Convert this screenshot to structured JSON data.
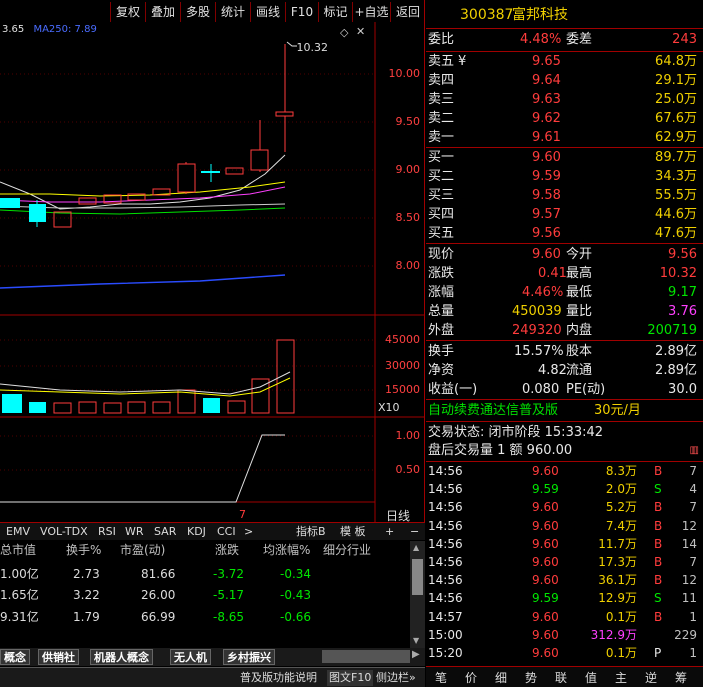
{
  "toolbar": {
    "items": [
      "复权",
      "叠加",
      "多股",
      "统计",
      "画线",
      "F10",
      "标记",
      "+自选",
      "返回"
    ]
  },
  "ma_label_left": "3.65",
  "ma_label": "MA250: 7.89",
  "high_mark": "10.32",
  "price_axis": [
    "10.00",
    "9.50",
    "9.00",
    "8.50",
    "8.00"
  ],
  "vol_axis": [
    "45000",
    "30000",
    "15000"
  ],
  "vol_unit": "X10",
  "ind_axis": [
    "1.00",
    "0.50"
  ],
  "period_label": "日线",
  "day_marker": "7",
  "indicator_tabs": [
    "EMV",
    "VOL-TDX",
    "RSI",
    "WR",
    "SAR",
    "KDJ",
    "CCI",
    ">"
  ],
  "indicator_extra": {
    "zhibiao": "指标B",
    "moban": "模 板",
    "plus": "+",
    "minus": "−"
  },
  "table": {
    "headers": [
      "总市值",
      "换手%",
      "市盈(动)",
      "涨跌",
      "均涨幅%",
      "细分行业"
    ],
    "rows": [
      [
        "1.00亿",
        "2.73",
        "81.66",
        "-3.72",
        "-0.34"
      ],
      [
        "1.65亿",
        "3.22",
        "26.00",
        "-5.17",
        "-0.43"
      ],
      [
        "9.31亿",
        "1.79",
        "66.99",
        "-8.65",
        "-0.66"
      ]
    ]
  },
  "concept_tabs": [
    "机器人概念",
    "供销社",
    "机器人概念",
    "无人机",
    "乡村振兴"
  ],
  "concept_tab_first": "概念",
  "status_bar": [
    "普及版功能说明",
    "图文F10",
    "侧边栏»"
  ],
  "stock": {
    "code": "300387",
    "name": "富邦科技"
  },
  "weibi": {
    "label": "委比",
    "value": "4.48%",
    "diff_label": "委差",
    "diff": "243"
  },
  "asks": [
    {
      "label": "卖五",
      "mark": "¥",
      "price": "9.65",
      "vol": "64.8万"
    },
    {
      "label": "卖四",
      "mark": "",
      "price": "9.64",
      "vol": "29.1万"
    },
    {
      "label": "卖三",
      "mark": "",
      "price": "9.63",
      "vol": "25.0万"
    },
    {
      "label": "卖二",
      "mark": "",
      "price": "9.62",
      "vol": "67.6万"
    },
    {
      "label": "卖一",
      "mark": "",
      "price": "9.61",
      "vol": "62.9万"
    }
  ],
  "bids": [
    {
      "label": "买一",
      "price": "9.60",
      "vol": "89.7万"
    },
    {
      "label": "买二",
      "price": "9.59",
      "vol": "34.3万"
    },
    {
      "label": "买三",
      "price": "9.58",
      "vol": "55.5万"
    },
    {
      "label": "买四",
      "price": "9.57",
      "vol": "44.6万"
    },
    {
      "label": "买五",
      "price": "9.56",
      "vol": "47.6万"
    }
  ],
  "quote": [
    {
      "l1": "现价",
      "v1": "9.60",
      "l2": "今开",
      "v2": "9.56"
    },
    {
      "l1": "涨跌",
      "v1": "0.41",
      "l2": "最高",
      "v2": "10.32"
    },
    {
      "l1": "涨幅",
      "v1": "4.46%",
      "l2": "最低",
      "v2": "9.17"
    },
    {
      "l1": "总量",
      "v1": "450039",
      "l2": "量比",
      "v2": "3.76"
    },
    {
      "l1": "外盘",
      "v1": "249320",
      "l2": "内盘",
      "v2": "200719"
    }
  ],
  "fin": [
    {
      "l1": "换手",
      "v1": "15.57%",
      "l2": "股本",
      "v2": "2.89亿"
    },
    {
      "l1": "净资",
      "v1": "4.82",
      "l2": "流通",
      "v2": "2.89亿"
    },
    {
      "l1": "收益(一)",
      "v1": "0.080",
      "l2": "PE(动)",
      "v2": "30.0"
    }
  ],
  "ad": {
    "text": "自动续费通达信普及版",
    "price": "30元/月"
  },
  "trade_status": "交易状态: 闭市阶段 15:33:42",
  "after_hours": "盘后交易量 1 额 960.00",
  "ticks": [
    {
      "t": "14:56",
      "p": "9.60",
      "v": "8.3万",
      "d": "B",
      "n": "7"
    },
    {
      "t": "14:56",
      "p": "9.59",
      "v": "2.0万",
      "d": "S",
      "n": "4"
    },
    {
      "t": "14:56",
      "p": "9.60",
      "v": "5.2万",
      "d": "B",
      "n": "7"
    },
    {
      "t": "14:56",
      "p": "9.60",
      "v": "7.4万",
      "d": "B",
      "n": "12"
    },
    {
      "t": "14:56",
      "p": "9.60",
      "v": "11.7万",
      "d": "B",
      "n": "14"
    },
    {
      "t": "14:56",
      "p": "9.60",
      "v": "17.3万",
      "d": "B",
      "n": "7"
    },
    {
      "t": "14:56",
      "p": "9.60",
      "v": "36.1万",
      "d": "B",
      "n": "12"
    },
    {
      "t": "14:56",
      "p": "9.59",
      "v": "12.9万",
      "d": "S",
      "n": "11"
    },
    {
      "t": "14:57",
      "p": "9.60",
      "v": "0.1万",
      "d": "B",
      "n": "1"
    },
    {
      "t": "15:00",
      "p": "9.60",
      "v": "312.9万",
      "d": "",
      "n": "229"
    },
    {
      "t": "15:20",
      "p": "9.60",
      "v": "0.1万",
      "d": "P",
      "n": "1"
    }
  ],
  "nav": [
    "笔",
    "价",
    "细",
    "势",
    "联",
    "值",
    "主",
    "逆",
    "筹"
  ],
  "colors": {
    "up": "#ff3c3c",
    "down": "#00e600",
    "border": "#a00000",
    "accent": "#f0d000"
  }
}
